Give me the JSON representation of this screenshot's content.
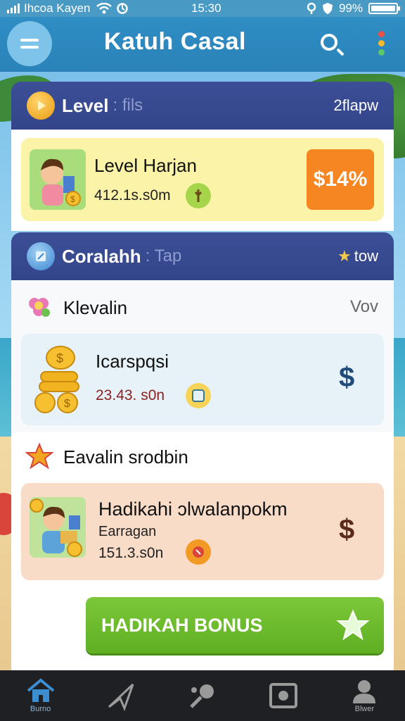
{
  "status_bar": {
    "carrier": "Ihcoa Kayen",
    "time": "15:30",
    "battery": "99%",
    "battery_level": 0.99
  },
  "header": {
    "title": "Katuh Casal",
    "menu_icon": "hamburger-icon",
    "search_icon": "search-icon",
    "more_icon": "traffic-dots-icon"
  },
  "colors": {
    "header": "#2f8ec4",
    "section_bar": "#3c4f96",
    "accent_orange": "#f68621",
    "bonus_green": "#6cbb2b",
    "card_yellow": "#fbf4a8",
    "card_blue": "#e6f2f8",
    "card_peach": "#f9dcc8"
  },
  "level_section": {
    "title": "Level",
    "subtitle": ": fils",
    "right": "2flapw",
    "card": {
      "title": "Level Harjan",
      "subtitle": "412.1s.s0m",
      "price": "$14%"
    }
  },
  "coin_section": {
    "title": "Coralahh",
    "subtitle": ": Tap",
    "right": "tow",
    "row_title": "Klevalin",
    "row_right": "Vov",
    "card": {
      "title": "Icarspqsi",
      "subtitle": "23.43. s0n",
      "dollar": "$"
    }
  },
  "evaluation": {
    "title": "Eavalin srodbin",
    "card": {
      "title": "Hadikahi ɔlwalanpokm",
      "label": "Earragan",
      "subtitle": "151.3.s0n",
      "dollar": "$"
    }
  },
  "bonus_button": {
    "label": "HADIKAH BONUS"
  },
  "bottom_nav": {
    "items": [
      {
        "label": "Burno",
        "icon": "home-icon",
        "active": true
      },
      {
        "label": "",
        "icon": "paper-plane-icon",
        "active": false
      },
      {
        "label": "",
        "icon": "ping-pong-icon",
        "active": false
      },
      {
        "label": "",
        "icon": "photo-frame-icon",
        "active": false
      },
      {
        "label": "Blwer",
        "icon": "user-icon",
        "active": false
      }
    ]
  }
}
